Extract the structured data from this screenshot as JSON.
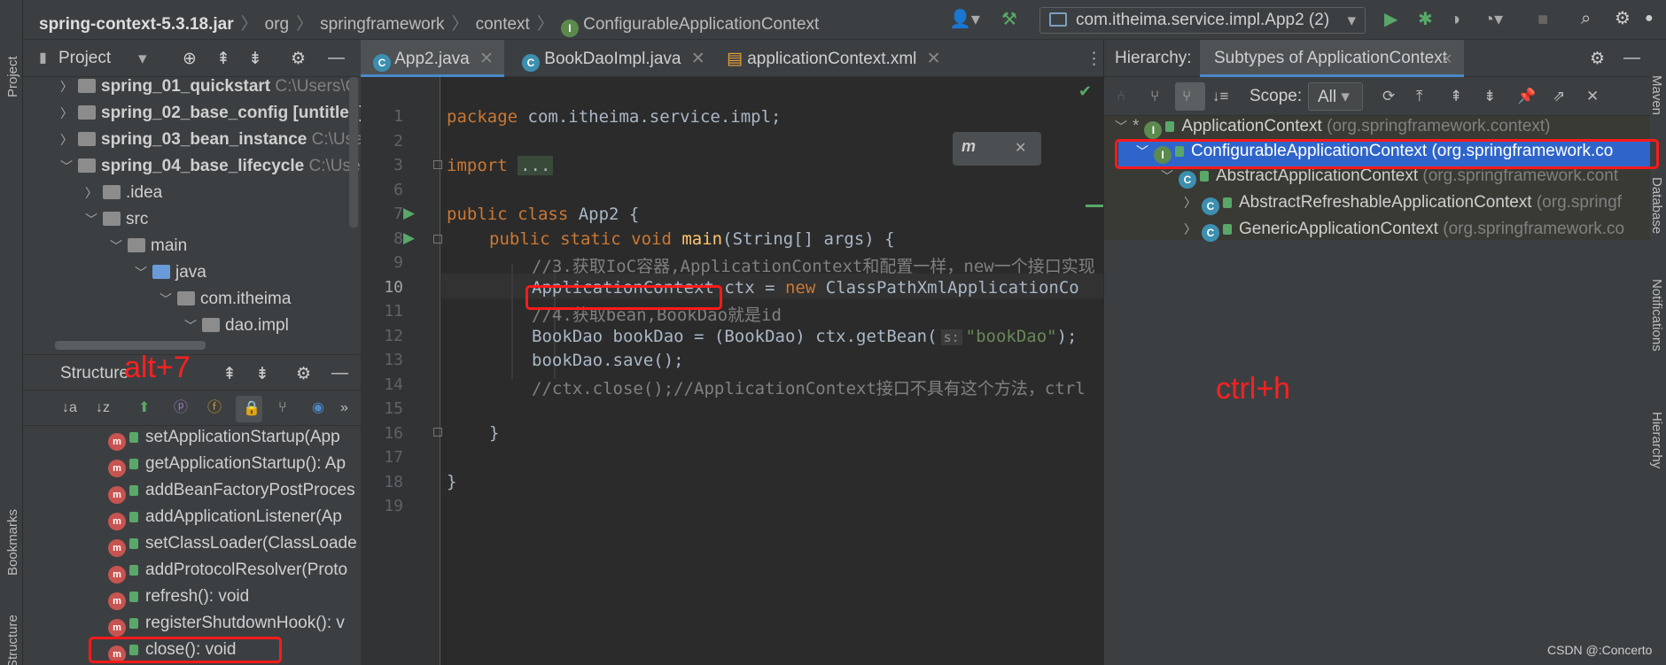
{
  "breadcrumb": {
    "jar": "spring-context-5.3.18.jar",
    "items": [
      "org",
      "springframework",
      "context",
      "ConfigurableApplicationContext"
    ]
  },
  "run_config": "com.itheima.service.impl.App2 (2)",
  "left_strip": {
    "project": "Project",
    "bookmarks": "Bookmarks",
    "structure": "Structure"
  },
  "right_strip": {
    "maven": "Maven",
    "database": "Database",
    "notifications": "Notifications",
    "hierarchy": "Hierarchy"
  },
  "project": {
    "title": "Project",
    "rows": [
      {
        "name": "spring_01_quickstart",
        "hint": "C:\\Users\\C"
      },
      {
        "name": "spring_02_base_config",
        "hint": "[untitled]"
      },
      {
        "name": "spring_03_bean_instance",
        "hint": "C:\\Use"
      },
      {
        "name": "spring_04_base_lifecycle",
        "hint": "C:\\User"
      },
      {
        "name": ".idea",
        "hint": ""
      },
      {
        "name": "src",
        "hint": ""
      },
      {
        "name": "main",
        "hint": ""
      },
      {
        "name": "java",
        "hint": ""
      },
      {
        "name": "com.itheima",
        "hint": ""
      },
      {
        "name": "dao.impl",
        "hint": ""
      }
    ]
  },
  "structure": {
    "title": "Structure",
    "methods": [
      "setApplicationStartup(App",
      "getApplicationStartup(): Ap",
      "addBeanFactoryPostProces",
      "addApplicationListener(Ap",
      "setClassLoader(ClassLoade",
      "addProtocolResolver(Proto",
      "refresh(): void",
      "registerShutdownHook(): v",
      "close(): void"
    ]
  },
  "tabs": [
    "App2.java",
    "BookDaoImpl.java",
    "applicationContext.xml"
  ],
  "code": {
    "line_numbers": [
      "1",
      "2",
      "3",
      "6",
      "7",
      "8",
      "9",
      "10",
      "11",
      "12",
      "13",
      "14",
      "15",
      "16",
      "17",
      "18",
      "19"
    ],
    "package_kw": "package",
    "package_name": " com.itheima.service.impl;",
    "import_kw": "import",
    "import_fold": "...",
    "class_decl_kw": "public class",
    "class_name": " App2 {",
    "main_kw": "public static void",
    "main_name": "main",
    "main_args": "(String[] args) {",
    "comment1": "//3.获取IoC容器,ApplicationContext和配置一样，new一个接口实现",
    "l10_type": "ApplicationContext",
    "l10_mid": " ctx = ",
    "l10_new": "new",
    "l10_rest": " ClassPathXmlApplicationCo",
    "comment2": "//4.获取bean,BookDao就是id",
    "l12_a": "BookDao bookDao = (BookDao) ctx.getBean(",
    "l12_hint": "s:",
    "l12_str": "\"bookDao\"",
    "l12_end": ");",
    "l13": "bookDao.save();",
    "comment3": "//ctx.close();//ApplicationContext接口不具有这个方法，ctrl",
    "brace_method": "}",
    "brace_class": "}"
  },
  "hierarchy": {
    "label": "Hierarchy:",
    "tab": "Subtypes of ApplicationContext",
    "scope_label": "Scope:",
    "scope_value": "All",
    "rows": [
      {
        "name": "ApplicationContext",
        "pkg": "(org.springframework.context)"
      },
      {
        "name": "ConfigurableApplicationContext",
        "pkg": "(org.springframework.co"
      },
      {
        "name": "AbstractApplicationContext",
        "pkg": "(org.springframework.cont"
      },
      {
        "name": "AbstractRefreshableApplicationContext",
        "pkg": "(org.springf"
      },
      {
        "name": "GenericApplicationContext",
        "pkg": "(org.springframework.co"
      }
    ]
  },
  "annotations": {
    "alt7": "alt+7",
    "ctrlh": "ctrl+h"
  },
  "watermark": "CSDN @:Concerto"
}
